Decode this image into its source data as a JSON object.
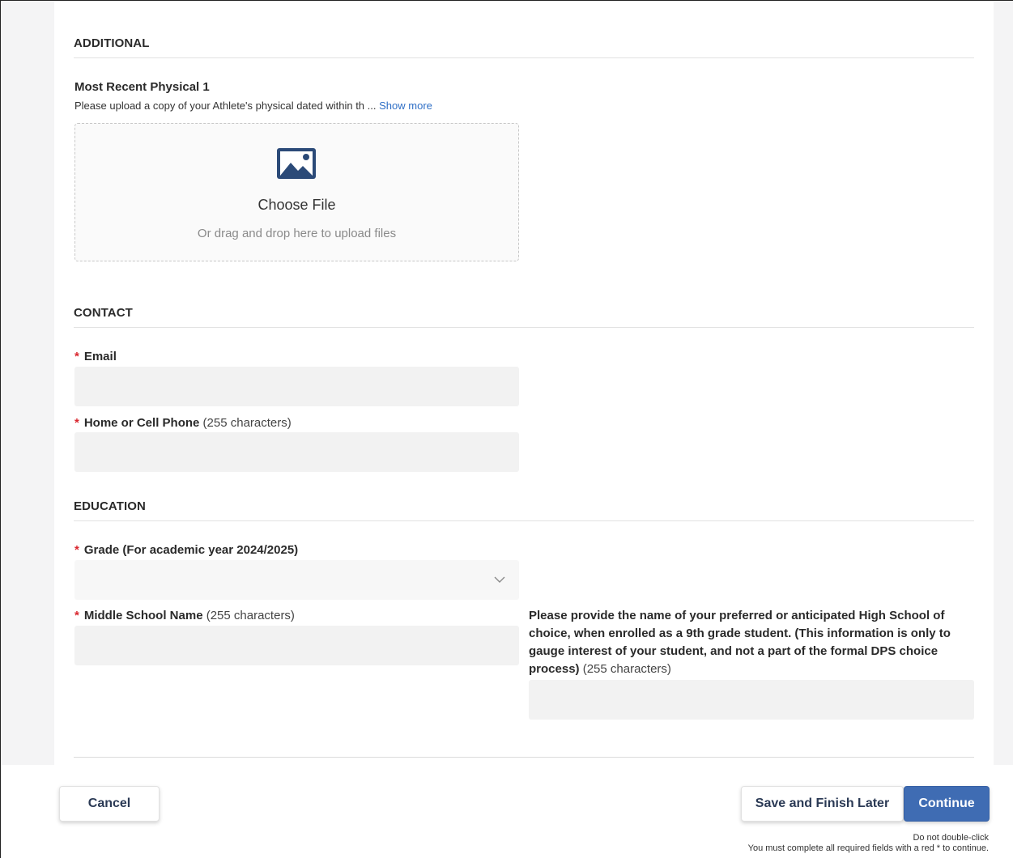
{
  "sections": {
    "additional": {
      "title": "ADDITIONAL",
      "physical_label": "Most Recent Physical 1",
      "physical_desc": "Please upload a copy of your Athlete's physical dated within th ...",
      "show_more": "Show more",
      "upload": {
        "choose_label": "Choose File",
        "drag_hint": "Or drag and drop here to upload files",
        "icon": "image-icon"
      }
    },
    "contact": {
      "title": "CONTACT",
      "email_label": "Email",
      "email_value": "",
      "phone_label": "Home or Cell Phone",
      "phone_hint": "(255 characters)",
      "phone_value": ""
    },
    "education": {
      "title": "EDUCATION",
      "grade_label": "Grade (For academic year 2024/2025)",
      "grade_value": "",
      "middle_school_label": "Middle School Name",
      "middle_school_hint": "(255 characters)",
      "middle_school_value": "",
      "high_school_label": "Please provide the name of your preferred or anticipated High School of choice, when enrolled as a 9th grade student. (This information is only to gauge interest of your student, and not a part of the formal DPS choice process)",
      "high_school_hint": "(255 characters)",
      "high_school_value": ""
    }
  },
  "required_marker": "*",
  "footer": {
    "cancel_label": "Cancel",
    "save_label": "Save and Finish Later",
    "continue_label": "Continue",
    "note_line1": "Do not double-click",
    "note_line2": "You must complete all required fields with a red * to continue."
  },
  "colors": {
    "accent": "#3f6cb3",
    "link": "#2f6fc6",
    "required": "#d9262e",
    "input_bg": "#f2f2f2"
  }
}
